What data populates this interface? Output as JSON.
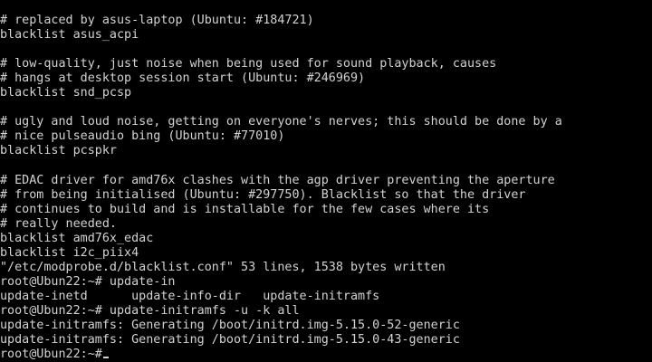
{
  "terminal": {
    "lines": [
      "# replaced by asus-laptop (Ubuntu: #184721)",
      "blacklist asus_acpi",
      "",
      "# low-quality, just noise when being used for sound playback, causes",
      "# hangs at desktop session start (Ubuntu: #246969)",
      "blacklist snd_pcsp",
      "",
      "# ugly and loud noise, getting on everyone's nerves; this should be done by a",
      "# nice pulseaudio bing (Ubuntu: #77010)",
      "blacklist pcspkr",
      "",
      "# EDAC driver for amd76x clashes with the agp driver preventing the aperture",
      "# from being initialised (Ubuntu: #297750). Blacklist so that the driver",
      "# continues to build and is installable for the few cases where its",
      "# really needed.",
      "blacklist amd76x_edac",
      "blacklist i2c_piix4",
      "\"/etc/modprobe.d/blacklist.conf\" 53 lines, 1538 bytes written",
      "root@Ubun22:~# update-in",
      "update-inetd      update-info-dir   update-initramfs",
      "root@Ubun22:~# update-initramfs -u -k all",
      "update-initramfs: Generating /boot/initrd.img-5.15.0-52-generic",
      "update-initramfs: Generating /boot/initrd.img-5.15.0-43-generic",
      "root@Ubun22:~#"
    ]
  }
}
